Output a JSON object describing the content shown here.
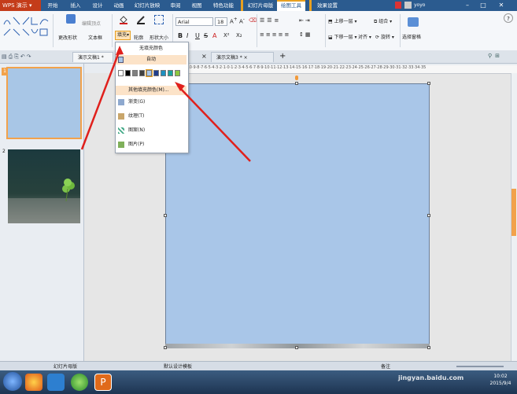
{
  "app": {
    "name": "WPS 演示"
  },
  "menu_tabs": [
    "开始",
    "插入",
    "设计",
    "动画",
    "幻灯片放映",
    "审阅",
    "视图",
    "特色功能",
    "幻灯片母版",
    "绘图工具",
    "效果设置"
  ],
  "user": "yoyo",
  "ribbon": {
    "edit_vertex": "编辑顶点",
    "change_shape": "更改形状",
    "text_box": "文本框",
    "fill": "填充",
    "outline": "轮廓",
    "shape_size": "形状大小",
    "font_name": "Arial",
    "font_size": "18",
    "bring_forward": "上移一层",
    "send_backward": "下移一层",
    "group": "组合",
    "align": "对齐",
    "rotate": "旋转",
    "selection_pane": "选择窗格",
    "format_buttons": [
      "B",
      "I",
      "U",
      "S",
      "A",
      "X²",
      "X₂"
    ]
  },
  "doc_tabs": [
    "演示文稿1 *",
    "演示文稿3 *"
  ],
  "new_tab": "+",
  "fill_menu": {
    "no_fill": "无填充颜色",
    "auto": "自动",
    "swatches": [
      "#ffffff",
      "#000000",
      "#808080",
      "#404040",
      "#a9c6e8",
      "#1f3e8c",
      "#1e90c0",
      "#1aa39a",
      "#8cc63f"
    ],
    "more_colors": "其他填充颜色(M)...",
    "gradient": "渐变(G)",
    "texture": "纹理(T)",
    "pattern": "图案(N)",
    "picture": "图片(P)"
  },
  "thumbnails": {
    "slide1": "1",
    "slide2": "2"
  },
  "ruler": "·10·9·8·7·6·5·4·3·2·1·0·1·2·3·4·5·6·7·8·9·10·11·12·13·14·15·16·17·18·19·20·21·22·23·24·25·26·27·28·29·30·31·32·33·34·35",
  "status": {
    "left": "幻灯片母版",
    "center": "默认设计模板",
    "zoom": "备注"
  },
  "clock": {
    "time": "10:02",
    "date": "2015/9/4"
  },
  "watermark": "jingyan.baidu.com",
  "colors": {
    "arrow": "#e0201c",
    "accent": "#e8a020",
    "slide_fill": "#a9c6e8"
  }
}
